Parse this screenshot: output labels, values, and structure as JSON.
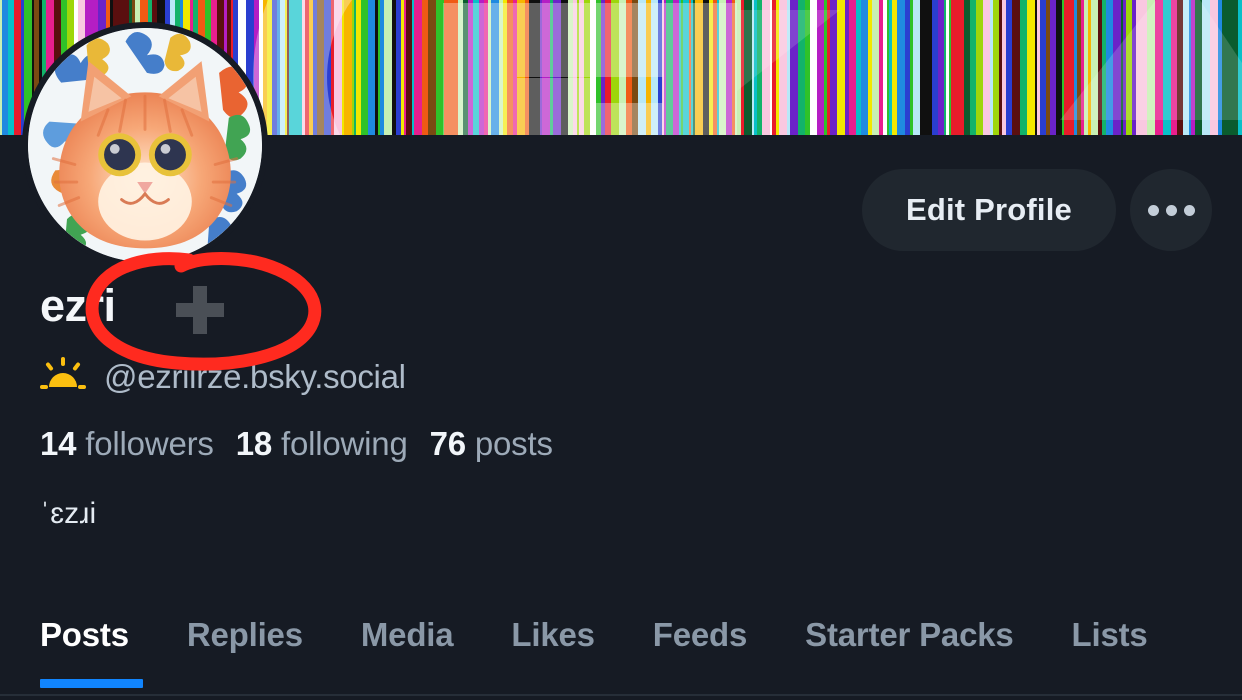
{
  "profile": {
    "display_name": "ezri",
    "handle": "@ezriirze.bsky.social",
    "bio": "ˈɛzɹi",
    "verified_plus_icon": "plus-icon",
    "status_emoji": "sunrise-emoji",
    "avatar_alt": "orange cat painting avatar",
    "banner_alt": "colorful vertical stripe banner"
  },
  "stats": {
    "followers_count": "14",
    "followers_label": "followers",
    "following_count": "18",
    "following_label": "following",
    "posts_count": "76",
    "posts_label": "posts"
  },
  "actions": {
    "edit_profile_label": "Edit Profile",
    "more_label": "···"
  },
  "tabs": [
    {
      "label": "Posts",
      "active": true
    },
    {
      "label": "Replies",
      "active": false
    },
    {
      "label": "Media",
      "active": false
    },
    {
      "label": "Likes",
      "active": false
    },
    {
      "label": "Feeds",
      "active": false
    },
    {
      "label": "Starter Packs",
      "active": false
    },
    {
      "label": "Lists",
      "active": false
    }
  ],
  "annotation": {
    "type": "hand-drawn-red-ellipse",
    "color": "#FF2A1F",
    "target": "display-name-plus-icon"
  },
  "colors": {
    "page_background": "#161B24",
    "accent_blue": "#1185FE",
    "button_background": "#20272F",
    "text_primary": "#F4F7FA",
    "text_secondary": "#9DAAB8",
    "plus_icon": "#4A4F56",
    "annotation_red": "#FF2A1F"
  }
}
